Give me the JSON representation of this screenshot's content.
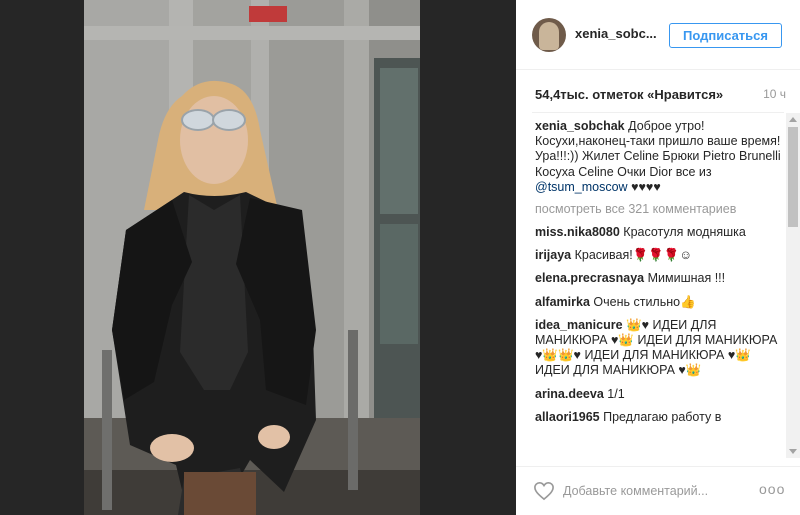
{
  "post": {
    "username": "xenia_sobc...",
    "follow_label": "Подписаться",
    "likes": "54,4тыс. отметок «Нравится»",
    "time": "10 ч"
  },
  "caption": {
    "user": "xenia_sobchak",
    "text": "Доброе утро! Косухи,наконец-таки пришло ваше время! Ура!!!:)) Жилет Celine Брюки Pietro Brunelli Косуха Celine Очки Dior все из",
    "mention": "@tsum_moscow",
    "tail": "♥♥♥♥"
  },
  "view_all": "посмотреть все 321 комментариев",
  "comments": [
    {
      "user": "miss.nika8080",
      "text": "Красотуля модняшка"
    },
    {
      "user": "irijaya",
      "text": "Красивая!🌹🌹🌹☺"
    },
    {
      "user": "elena.precrasnaya",
      "text": "Мимишная !!!"
    },
    {
      "user": "alfamirka",
      "text": "Очень стильно👍"
    },
    {
      "user": "idea_manicure",
      "text": "👑♥ ИДЕИ ДЛЯ МАНИКЮРА ♥👑 ИДЕИ ДЛЯ МАНИКЮРА ♥👑👑♥ ИДЕИ ДЛЯ МАНИКЮРА ♥👑 ИДЕИ ДЛЯ МАНИКЮРА ♥👑"
    },
    {
      "user": "arina.deeva",
      "text": "1/1"
    },
    {
      "user": "allaori1965",
      "text": "Предлагаю работу в"
    }
  ],
  "footer": {
    "placeholder": "Добавьте комментарий...",
    "more": "ooo"
  },
  "colors": {
    "accent": "#3897f0",
    "mention": "#003569",
    "muted": "#999999"
  },
  "icons": {
    "like": "heart-outline-icon",
    "more": "three-dots-icon"
  }
}
